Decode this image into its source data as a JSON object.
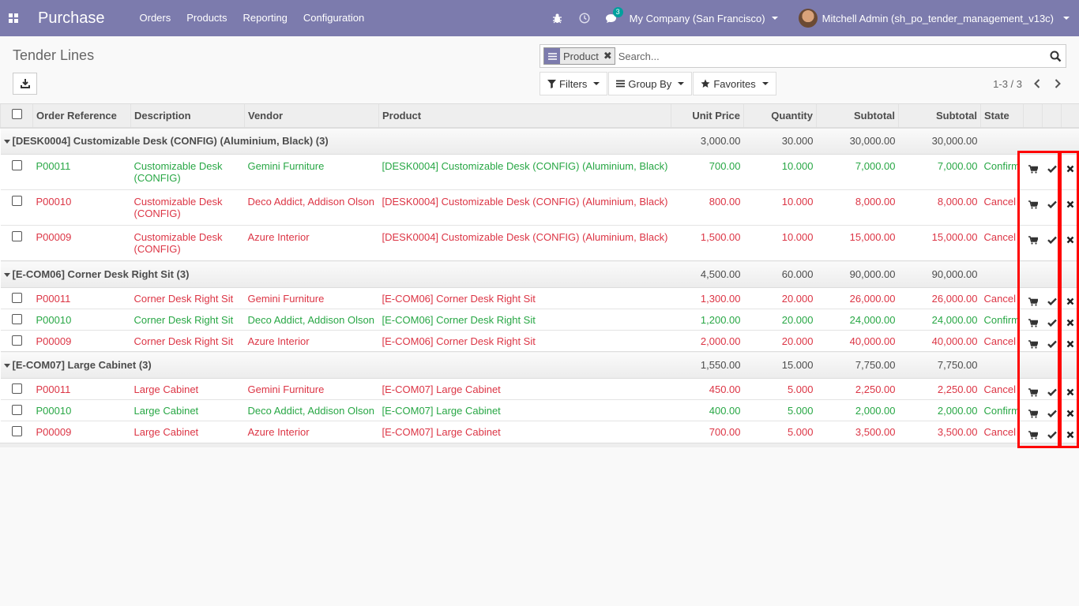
{
  "navbar": {
    "app_name": "Purchase",
    "menu": [
      "Orders",
      "Products",
      "Reporting",
      "Configuration"
    ],
    "messages_count": "3",
    "company": "My Company (San Francisco)",
    "user": "Mitchell Admin (sh_po_tender_management_v13c)",
    "color": "#7c7bad"
  },
  "control_panel": {
    "title": "Tender Lines",
    "search": {
      "facet_value": "Product",
      "placeholder": "Search..."
    },
    "filters_label": "Filters",
    "group_by_label": "Group By",
    "favorites_label": "Favorites",
    "pager": "1-3 / 3"
  },
  "table": {
    "columns": [
      "Order Reference",
      "Description",
      "Vendor",
      "Product",
      "Unit Price",
      "Quantity",
      "Subtotal",
      "Subtotal",
      "State"
    ],
    "groups": [
      {
        "label": "[DESK0004] Customizable Desk (CONFIG) (Aluminium, Black) (3)",
        "unit_price": "3,000.00",
        "quantity": "30.000",
        "subtotal1": "30,000.00",
        "subtotal2": "30,000.00",
        "rows": [
          {
            "ref": "P00011",
            "desc": "Customizable Desk (CONFIG)",
            "vendor": "Gemini Furniture",
            "product": "[DESK0004] Customizable Desk (CONFIG) (Aluminium, Black)",
            "price": "700.00",
            "qty": "10.000",
            "sub1": "7,000.00",
            "sub2": "7,000.00",
            "state": "Confirm",
            "status": "confirm"
          },
          {
            "ref": "P00010",
            "desc": "Customizable Desk (CONFIG)",
            "vendor": "Deco Addict, Addison Olson",
            "product": "[DESK0004] Customizable Desk (CONFIG) (Aluminium, Black)",
            "price": "800.00",
            "qty": "10.000",
            "sub1": "8,000.00",
            "sub2": "8,000.00",
            "state": "Cancel",
            "status": "cancel"
          },
          {
            "ref": "P00009",
            "desc": "Customizable Desk (CONFIG)",
            "vendor": "Azure Interior",
            "product": "[DESK0004] Customizable Desk (CONFIG) (Aluminium, Black)",
            "price": "1,500.00",
            "qty": "10.000",
            "sub1": "15,000.00",
            "sub2": "15,000.00",
            "state": "Cancel",
            "status": "cancel"
          }
        ]
      },
      {
        "label": "[E-COM06] Corner Desk Right Sit (3)",
        "unit_price": "4,500.00",
        "quantity": "60.000",
        "subtotal1": "90,000.00",
        "subtotal2": "90,000.00",
        "rows": [
          {
            "ref": "P00011",
            "desc": "Corner Desk Right Sit",
            "vendor": "Gemini Furniture",
            "product": "[E-COM06] Corner Desk Right Sit",
            "price": "1,300.00",
            "qty": "20.000",
            "sub1": "26,000.00",
            "sub2": "26,000.00",
            "state": "Cancel",
            "status": "cancel"
          },
          {
            "ref": "P00010",
            "desc": "Corner Desk Right Sit",
            "vendor": "Deco Addict, Addison Olson",
            "product": "[E-COM06] Corner Desk Right Sit",
            "price": "1,200.00",
            "qty": "20.000",
            "sub1": "24,000.00",
            "sub2": "24,000.00",
            "state": "Confirm",
            "status": "confirm"
          },
          {
            "ref": "P00009",
            "desc": "Corner Desk Right Sit",
            "vendor": "Azure Interior",
            "product": "[E-COM06] Corner Desk Right Sit",
            "price": "2,000.00",
            "qty": "20.000",
            "sub1": "40,000.00",
            "sub2": "40,000.00",
            "state": "Cancel",
            "status": "cancel"
          }
        ]
      },
      {
        "label": "[E-COM07] Large Cabinet (3)",
        "unit_price": "1,550.00",
        "quantity": "15.000",
        "subtotal1": "7,750.00",
        "subtotal2": "7,750.00",
        "rows": [
          {
            "ref": "P00011",
            "desc": "Large Cabinet",
            "vendor": "Gemini Furniture",
            "product": "[E-COM07] Large Cabinet",
            "price": "450.00",
            "qty": "5.000",
            "sub1": "2,250.00",
            "sub2": "2,250.00",
            "state": "Cancel",
            "status": "cancel"
          },
          {
            "ref": "P00010",
            "desc": "Large Cabinet",
            "vendor": "Deco Addict, Addison Olson",
            "product": "[E-COM07] Large Cabinet",
            "price": "400.00",
            "qty": "5.000",
            "sub1": "2,000.00",
            "sub2": "2,000.00",
            "state": "Confirm",
            "status": "confirm"
          },
          {
            "ref": "P00009",
            "desc": "Large Cabinet",
            "vendor": "Azure Interior",
            "product": "[E-COM07] Large Cabinet",
            "price": "700.00",
            "qty": "5.000",
            "sub1": "3,500.00",
            "sub2": "3,500.00",
            "state": "Cancel",
            "status": "cancel"
          }
        ]
      }
    ]
  },
  "colors": {
    "confirm": "#28a745",
    "cancel": "#dc3545",
    "highlight": "#ff0000"
  }
}
